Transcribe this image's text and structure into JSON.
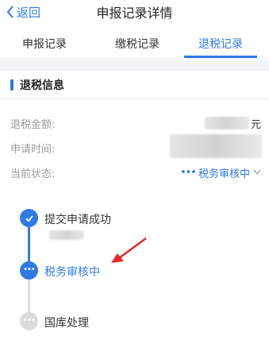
{
  "header": {
    "back_label": "返回",
    "title": "申报记录详情"
  },
  "tabs": [
    {
      "label": "申报记录",
      "active": false
    },
    {
      "label": "缴税记录",
      "active": false
    },
    {
      "label": "退税记录",
      "active": true
    }
  ],
  "section": {
    "title": "退税信息"
  },
  "fields": {
    "amount_label": "退税金额:",
    "amount_unit": "元",
    "time_label": "申请时间:",
    "status_label": "当前状态:",
    "status_value": "税务审核中"
  },
  "timeline": [
    {
      "label": "提交申请成功",
      "state": "done"
    },
    {
      "label": "税务审核中",
      "state": "current"
    },
    {
      "label": "国库处理",
      "state": "pending"
    }
  ],
  "colors": {
    "accent": "#2f7ae6",
    "annotation_arrow": "#e8262a"
  }
}
